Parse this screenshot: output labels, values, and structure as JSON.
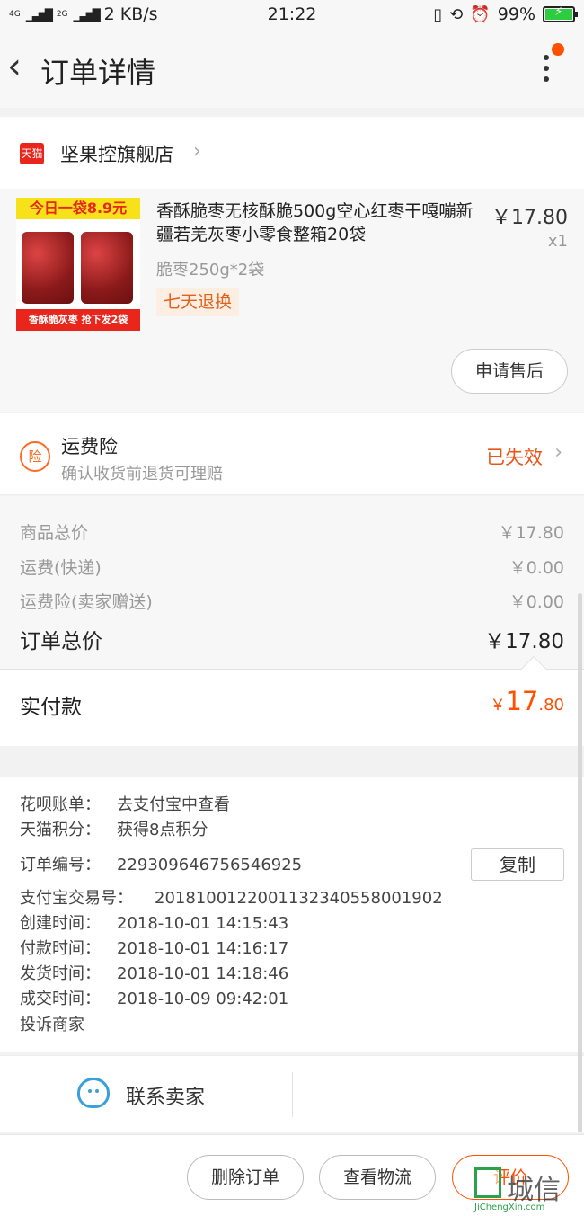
{
  "status_bar": {
    "network_tags": [
      "4G",
      "2G"
    ],
    "speed": "2 KB/s",
    "time": "21:22",
    "battery": "99%",
    "battery_level": 0.99
  },
  "nav": {
    "title": "订单详情"
  },
  "store": {
    "badge": "天猫",
    "name": "坚果控旗舰店"
  },
  "product": {
    "image_top_banner": "今日一袋8.9元",
    "image_bottom_banner": "香酥脆灰枣 抢下发2袋",
    "title": "香酥脆枣无核酥脆500g空心红枣干嘎嘣新疆若羌灰枣小零食整箱20袋",
    "price": "￥17.80",
    "qty": "x1",
    "spec": "脆枣250g*2袋",
    "tag": "七天退换",
    "after_sale_button": "申请售后"
  },
  "insurance": {
    "icon": "险",
    "title": "运费险",
    "desc": "确认收货前退货可理赔",
    "status": "已失效"
  },
  "summary": {
    "rows": [
      {
        "label": "商品总价",
        "value": "￥17.80"
      },
      {
        "label": "运费(快递)",
        "value": "￥0.00"
      },
      {
        "label": "运费险(卖家赠送)",
        "value": "￥0.00"
      }
    ],
    "total_label": "订单总价",
    "total_value": "￥17.80",
    "paid_label": "实付款",
    "paid_currency": "￥",
    "paid_int": "17",
    "paid_dec": ".80"
  },
  "info": {
    "huabei_key": "花呗账单：",
    "huabei_val": "去支付宝中查看",
    "points_key": "天猫积分：",
    "points_val": "获得8点积分",
    "order_no_key": "订单编号：",
    "order_no_val": "229309646756546925",
    "copy_button": "复制",
    "alipay_key": "支付宝交易号：",
    "alipay_val": "2018100122001132340558001902",
    "created_key": "创建时间：",
    "created_val": "2018-10-01 14:15:43",
    "paid_key": "付款时间：",
    "paid_val": "2018-10-01 14:16:17",
    "shipped_key": "发货时间：",
    "shipped_val": "2018-10-01 14:18:46",
    "closed_key": "成交时间：",
    "closed_val": "2018-10-09 09:42:01",
    "complaint": "投诉商家"
  },
  "contact": {
    "label": "联系卖家"
  },
  "bottom_bar": {
    "delete": "删除订单",
    "logistics": "查看物流",
    "review": "评价"
  },
  "watermark": {
    "text": "城信",
    "sub": "JiChengXin.com"
  }
}
